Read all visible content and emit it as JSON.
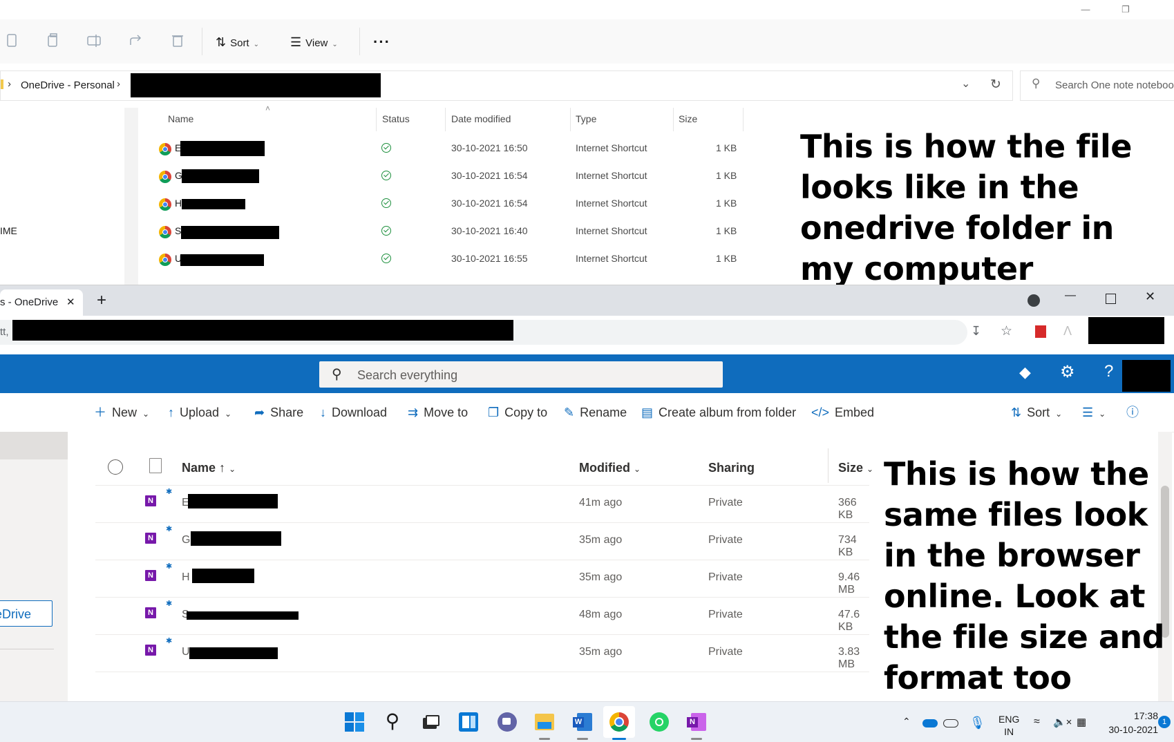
{
  "explorer": {
    "toolbar": {
      "sort_label": "Sort",
      "view_label": "View",
      "more_label": "···"
    },
    "breadcrumb": {
      "root": "OneDrive - Personal",
      "sep": "›"
    },
    "search_placeholder": "Search One note noteboo",
    "nav_partial_label": "IME",
    "columns": {
      "name": "Name",
      "status": "Status",
      "date": "Date modified",
      "type": "Type",
      "size": "Size"
    },
    "rows": [
      {
        "initial": "E",
        "date": "30-10-2021 16:50",
        "type": "Internet Shortcut",
        "size": "1 KB"
      },
      {
        "initial": "G",
        "date": "30-10-2021 16:54",
        "type": "Internet Shortcut",
        "size": "1 KB"
      },
      {
        "initial": "H",
        "date": "30-10-2021 16:54",
        "type": "Internet Shortcut",
        "size": "1 KB"
      },
      {
        "initial": "S",
        "date": "30-10-2021 16:40",
        "type": "Internet Shortcut",
        "size": "1 KB"
      },
      {
        "initial": "U",
        "date": "30-10-2021 16:55",
        "type": "Internet Shortcut",
        "size": "1 KB"
      }
    ]
  },
  "annotations": {
    "top": [
      "This is how the file",
      "looks like in the",
      "onedrive folder in",
      "my computer"
    ],
    "bottom": [
      "This is how the",
      "same files look",
      "in the browser",
      "online. Look at",
      "the file size and",
      "format too"
    ]
  },
  "browser": {
    "tab_title": "s - OneDrive",
    "tab_close": "✕",
    "new_tab": "+",
    "url_prefix": "tt,",
    "search_placeholder": "Search everything",
    "commands": {
      "new": "New",
      "upload": "Upload",
      "share": "Share",
      "download": "Download",
      "move_to": "Move to",
      "copy_to": "Copy to",
      "rename": "Rename",
      "create_album": "Create album from folder",
      "embed": "Embed",
      "sort": "Sort"
    },
    "left_nav_button": "eDrive",
    "columns": {
      "name": "Name",
      "modified": "Modified",
      "sharing": "Sharing",
      "size": "Size"
    },
    "rows": [
      {
        "initial": "E",
        "modified": "41m ago",
        "sharing": "Private",
        "size": "366 KB"
      },
      {
        "initial": "G",
        "modified": "35m ago",
        "sharing": "Private",
        "size": "734 KB"
      },
      {
        "initial": "H",
        "modified": "35m ago",
        "sharing": "Private",
        "size": "9.46 MB"
      },
      {
        "initial": "S",
        "modified": "48m ago",
        "sharing": "Private",
        "size": "47.6 KB"
      },
      {
        "initial": "U",
        "modified": "35m ago",
        "sharing": "Private",
        "size": "3.83 MB"
      }
    ]
  },
  "taskbar": {
    "lang_top": "ENG",
    "lang_bottom": "IN",
    "time": "17:38",
    "date": "30-10-2021",
    "notification_count": "1"
  },
  "colors": {
    "onedrive_blue": "#0f6cbd",
    "onenote_purple": "#7719aa",
    "synced_green": "#1c8f3c"
  }
}
